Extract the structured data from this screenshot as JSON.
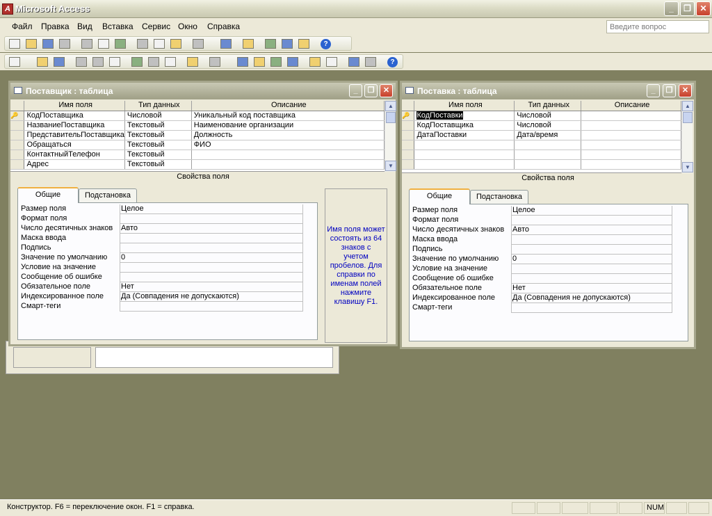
{
  "app": {
    "title": "Microsoft Access",
    "icon": "access-icon"
  },
  "window_controls": {
    "minimize": "_",
    "maximize": "❐",
    "close": "✕"
  },
  "menu": [
    "Файл",
    "Правка",
    "Вид",
    "Вставка",
    "Сервис",
    "Окно",
    "Справка"
  ],
  "help_search": {
    "placeholder": "Введите вопрос"
  },
  "toolbar_icons_row1": [
    "new-icon",
    "open-icon",
    "save-icon",
    "search-icon",
    "print-icon",
    "preview-icon",
    "spelling-icon",
    "cut-icon",
    "copy-icon",
    "paste-icon",
    "undo-icon",
    "office-links-icon",
    "analyze-icon",
    "properties-icon",
    "relationships-icon",
    "new-object-icon",
    "help-icon"
  ],
  "toolbar_icons_row2": [
    "view-icon",
    "save-icon",
    "search-icon",
    "print-icon",
    "preview-icon",
    "spelling-icon",
    "cut-icon",
    "copy-icon",
    "paste-icon",
    "undo-icon",
    "redo-icon",
    "primary-key-icon",
    "indexes-icon",
    "insert-rows-icon",
    "delete-rows-icon",
    "properties-icon",
    "build-icon",
    "database-window-icon",
    "new-object-icon",
    "help-icon"
  ],
  "win1": {
    "title": "Поставщик : таблица",
    "columns": [
      "Имя поля",
      "Тип данных",
      "Описание"
    ],
    "rows": [
      {
        "name": "КодПоставщика",
        "type": "Числовой",
        "desc": "Уникальный код поставщика",
        "key": "🔑"
      },
      {
        "name": "НазваниеПоставщика",
        "type": "Текстовый",
        "desc": "Наименование организации",
        "key": ""
      },
      {
        "name": "ПредставительПоставщика",
        "type": "Текстовый",
        "desc": "Должность",
        "key": ""
      },
      {
        "name": "Обращаться",
        "type": "Текстовый",
        "desc": "ФИО",
        "key": ""
      },
      {
        "name": "КонтактныйТелефон",
        "type": "Текстовый",
        "desc": "",
        "key": ""
      },
      {
        "name": "Адрес",
        "type": "Текстовый",
        "desc": "",
        "key": ""
      }
    ],
    "props_label": "Свойства поля",
    "tabs": [
      "Общие",
      "Подстановка"
    ],
    "props": [
      {
        "label": "Размер поля",
        "value": "Целое"
      },
      {
        "label": "Формат поля",
        "value": ""
      },
      {
        "label": "Число десятичных знаков",
        "value": "Авто"
      },
      {
        "label": "Маска ввода",
        "value": ""
      },
      {
        "label": "Подпись",
        "value": ""
      },
      {
        "label": "Значение по умолчанию",
        "value": "0"
      },
      {
        "label": "Условие на значение",
        "value": ""
      },
      {
        "label": "Сообщение об ошибке",
        "value": ""
      },
      {
        "label": "Обязательное поле",
        "value": "Нет"
      },
      {
        "label": "Индексированное поле",
        "value": "Да (Совпадения не допускаются)"
      },
      {
        "label": "Смарт-теги",
        "value": ""
      }
    ],
    "hint_lines": [
      "Имя поля может",
      "состоять из 64",
      "знаков с",
      "учетом",
      "пробелов.  Для",
      "справки по",
      "именам полей",
      "нажмите",
      "клавишу F1."
    ]
  },
  "win2": {
    "title": "Поставка : таблица",
    "columns": [
      "Имя поля",
      "Тип данных",
      "Описание"
    ],
    "rows": [
      {
        "name": "КодПоставки",
        "type": "Числовой",
        "desc": "",
        "key": "🔑"
      },
      {
        "name": "КодПоставщика",
        "type": "Числовой",
        "desc": "",
        "key": ""
      },
      {
        "name": "ДатаПоставки",
        "type": "Дата/время",
        "desc": "",
        "key": ""
      },
      {
        "name": "",
        "type": "",
        "desc": "",
        "key": ""
      },
      {
        "name": "",
        "type": "",
        "desc": "",
        "key": ""
      },
      {
        "name": "",
        "type": "",
        "desc": "",
        "key": ""
      }
    ],
    "props_label": "Свойства поля",
    "tabs": [
      "Общие",
      "Подстановка"
    ],
    "props": [
      {
        "label": "Размер поля",
        "value": "Целое"
      },
      {
        "label": "Формат поля",
        "value": ""
      },
      {
        "label": "Число десятичных знаков",
        "value": "Авто"
      },
      {
        "label": "Маска ввода",
        "value": ""
      },
      {
        "label": "Подпись",
        "value": ""
      },
      {
        "label": "Значение по умолчанию",
        "value": "0"
      },
      {
        "label": "Условие на значение",
        "value": ""
      },
      {
        "label": "Сообщение об ошибке",
        "value": ""
      },
      {
        "label": "Обязательное поле",
        "value": "Нет"
      },
      {
        "label": "Индексированное поле",
        "value": "Да (Совпадения не допускаются)"
      },
      {
        "label": "Смарт-теги",
        "value": ""
      }
    ]
  },
  "status": {
    "text": "Конструктор.  F6 = переключение окон.  F1 = справка.",
    "num": "NUM"
  },
  "colors": {
    "workspace": "#808060",
    "titlebar": "#9f9f86",
    "accent_tab": "#f0b040",
    "hint_text": "#0000c0"
  }
}
